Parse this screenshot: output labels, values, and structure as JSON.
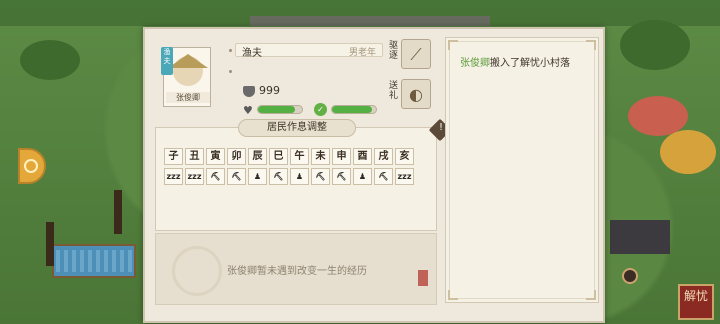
{
  "resident": {
    "name": "张俊卿",
    "job_tag": "渔夫",
    "job": "渔夫",
    "job_meta": "男老年",
    "money": "999"
  },
  "status": {
    "health_fraction": 0.85,
    "stamina_fraction": 0.9
  },
  "actions": {
    "expel_label": "驱逐",
    "gift_label": "送礼"
  },
  "schedule": {
    "title": "居民作息调整",
    "hours": [
      "子",
      "丑",
      "寅",
      "卯",
      "辰",
      "巳",
      "午",
      "未",
      "申",
      "酉",
      "戌",
      "亥"
    ],
    "activities": [
      "zzz",
      "zzz",
      "work",
      "work",
      "eat",
      "work",
      "eat",
      "work",
      "work",
      "eat",
      "work",
      "zzz"
    ]
  },
  "experience": {
    "text": "张俊卿暂未遇到改变一生的经历"
  },
  "log": {
    "who": "张俊卿",
    "text": "搬入了解忧小村落"
  },
  "hud": {
    "unravel_label": "解忧"
  },
  "colors": {
    "accent_green": "#55b043",
    "panel_bg": "#efe9dd"
  }
}
